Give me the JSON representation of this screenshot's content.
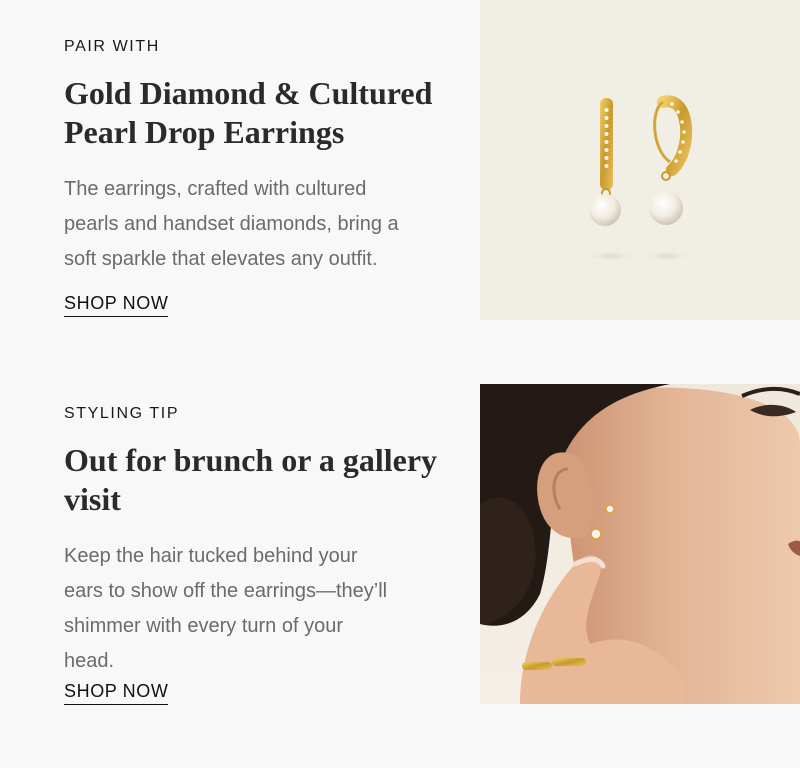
{
  "sections": [
    {
      "eyebrow": "PAIR WITH",
      "title_line1": "Gold Diamond & Cultured",
      "title_line2": "Pearl Drop Earrings",
      "body_line1": "The earrings, crafted with cultured",
      "body_line2": "pearls and handset diamonds, bring a",
      "body_line3": "soft sparkle that elevates any outfit.",
      "cta": "SHOP NOW",
      "image": "earrings-product-photo"
    },
    {
      "eyebrow": "STYLING TIP",
      "title_line1": "Out for brunch or a gallery",
      "title_line2": "visit",
      "body_line1": "Keep the hair tucked behind your",
      "body_line2": "ears to show off the earrings—they’ll",
      "body_line3": "shimmer with every turn of your",
      "body_line4": "head.",
      "cta": "SHOP NOW",
      "image": "model-wearing-earrings-photo"
    }
  ],
  "colors": {
    "page_bg": "#f8f8f8",
    "product_bg": "#f1efe5",
    "gold": "#d4a63a",
    "text_muted": "#6f6a66"
  }
}
